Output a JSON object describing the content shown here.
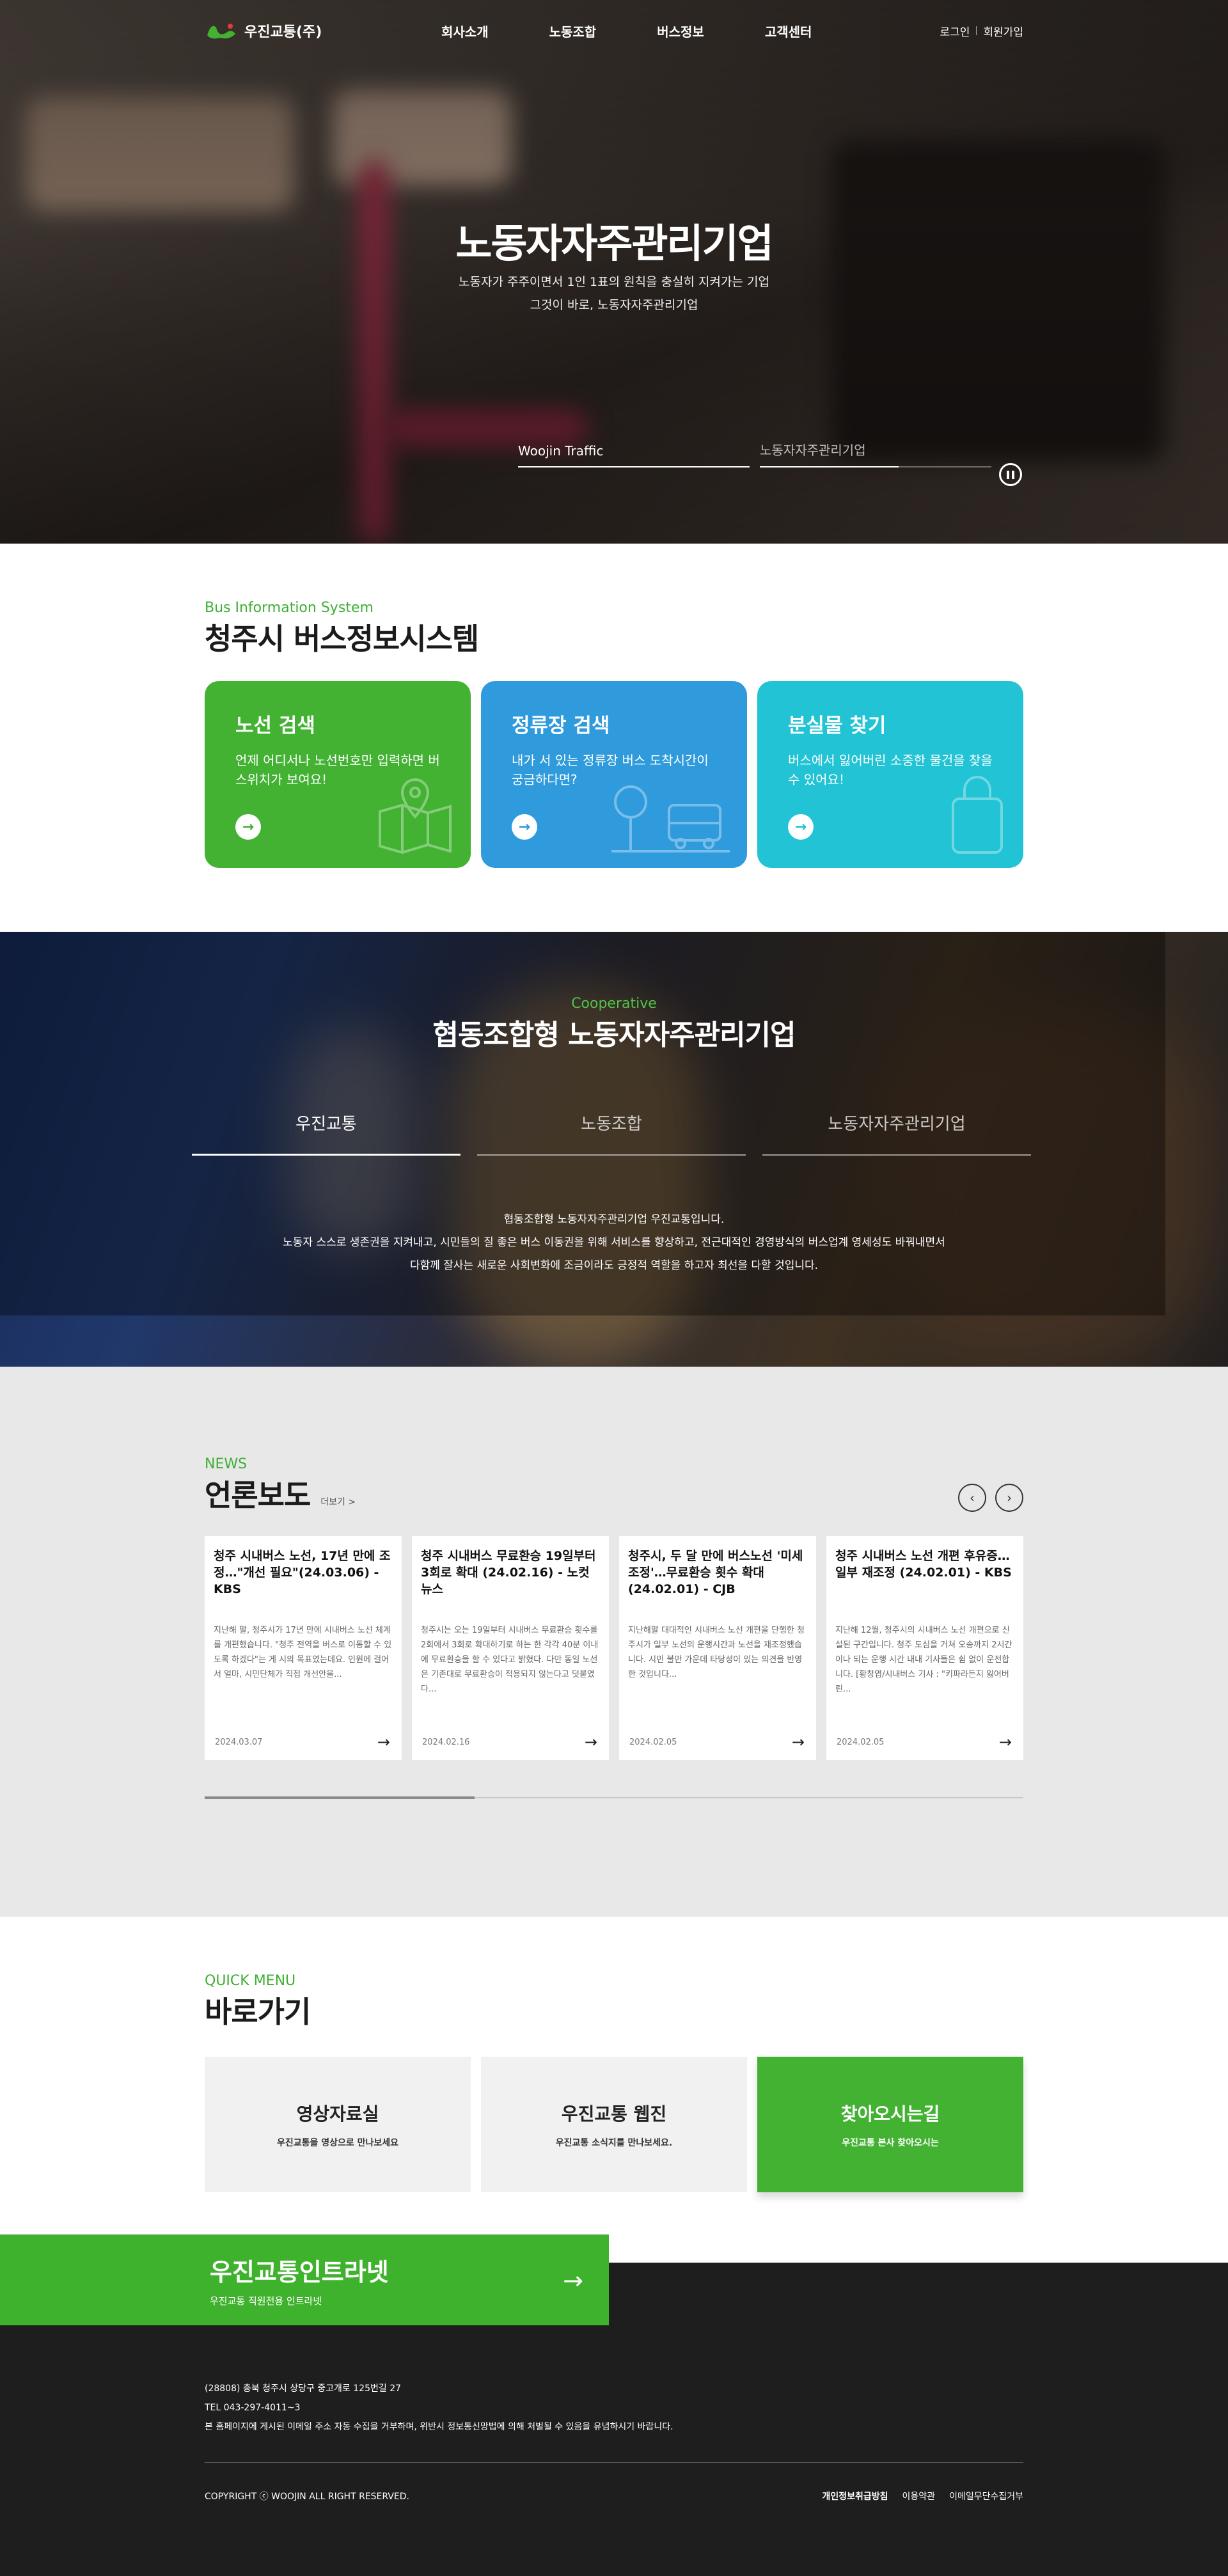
{
  "header": {
    "logo_text": "우진교통(주)",
    "nav": [
      "회사소개",
      "노동조합",
      "버스정보",
      "고객센터"
    ],
    "login": "로그인",
    "join": "회원가입"
  },
  "hero": {
    "title": "노동자자주관리기업",
    "line1": "노동자가 주주이면서 1인 1표의 원칙을 충실히 지켜가는 기업",
    "line2": "그것이 바로, 노동자자주관리기업",
    "tabs": [
      {
        "label": "Woojin Traffic",
        "progress": 1.0
      },
      {
        "label": "노동자자주관리기업",
        "progress": 0.6
      }
    ]
  },
  "bis": {
    "eyebrow": "Bus Information System",
    "title": "청주시 버스정보시스템",
    "cards": [
      {
        "title": "노선 검색",
        "desc": "언제 어디서나 노선번호만 입력하면 버스위치가 보여요!",
        "color": "#43b233",
        "icon": "map-pin-icon"
      },
      {
        "title": "정류장 검색",
        "desc": "내가 서 있는 정류장 버스 도착시간이 궁금하다면?",
        "color": "#2f9bdc",
        "icon": "bus-stop-icon"
      },
      {
        "title": "분실물 찾기",
        "desc": "버스에서 잃어버린 소중한 물건을 찾을 수 있어요!",
        "color": "#21c3d4",
        "icon": "bag-icon"
      }
    ]
  },
  "coop": {
    "eyebrow": "Cooperative",
    "title": "협동조합형 노동자자주관리기업",
    "tabs": [
      "우진교통",
      "노동조합",
      "노동자자주관리기업"
    ],
    "desc1": "협동조합형 노동자자주관리기업 우진교통입니다.",
    "desc2": "노동자 스스로 생존권을 지켜내고, 시민들의 질 좋은 버스 이동권을 위해 서비스를 향상하고, 전근대적인 경영방식의 버스업계 영세성도 바꿔내면서",
    "desc3": "다함께 잘사는 새로운 사회변화에 조금이라도 긍정적 역할을 하고자 최선을 다할 것입니다."
  },
  "news": {
    "eyebrow": "NEWS",
    "title": "언론보도",
    "more": "더보기 >",
    "items": [
      {
        "title": "청주 시내버스 노선, 17년 만에 조정…\"개선 필요\"(24.03.06) - KBS",
        "body": "지난해 말, 청주시가 17년 만에 시내버스 노선 체계를 개편했습니다. \"청주 전역을 버스로 이동할 수 있도록 하겠다\"는 게 시의 목표였는데요. 인원에 걸어서 얼마, 시민단체가 직접 개선안을...",
        "date": "2024.03.07"
      },
      {
        "title": "청주 시내버스 무료환승 19일부터 3회로 확대 (24.02.16) - 노컷뉴스",
        "body": "청주시는 오는 19일부터 시내버스 무료환승 횟수를 2회에서 3회로 확대하기로 하는 한 각각 40분 이내에 무료환승을 할 수 있다고 밝혔다. 다만 동일 노선은 기존대로 무료환승이 적용되지 않는다고 덧붙였다...",
        "date": "2024.02.16"
      },
      {
        "title": "청주시, 두 달 만에 버스노선 '미세조정'…무료환승 횟수 확대 (24.02.01) - CJB",
        "body": "지난해말 대대적인 시내버스 노선 개편을 단행한 청주시가 일부 노선의 운행시간과 노선을 재조정했습니다. 시민 불만 가운데 타당성이 있는 의견을 반영한 것입니다...",
        "date": "2024.02.05"
      },
      {
        "title": "청주 시내버스 노선 개편 후유증…일부 재조정 (24.02.01) - KBS",
        "body": "지난해 12월, 청주시의 시내버스 노선 개편으로 신설된 구간입니다. 청주 도심을 거쳐 오송까지 2시간이나 되는 운행 시간 내내 기사들은 쉼 없이 운전합니다. [황창엽/시내버스 기사 : \"키파라든지 잃어버린...",
        "date": "2024.02.05"
      }
    ],
    "progress": 0.33
  },
  "quick": {
    "eyebrow": "QUICK MENU",
    "title": "바로가기",
    "items": [
      {
        "title": "영상자료실",
        "desc": "우진교통을 영상으로 만나보세요",
        "active": false
      },
      {
        "title": "우진교통 웹진",
        "desc": "우진교통 소식지를 만나보세요.",
        "active": false
      },
      {
        "title": "찾아오시는길",
        "desc": "우진교통 본사 찾아오시는",
        "active": true
      }
    ]
  },
  "intranet": {
    "title": "우진교통인트라넷",
    "desc": "우진교통 직원전용 인트라넷"
  },
  "footer": {
    "addr": "(28808) 충북 청주시 상당구 중고개로 125번길 27",
    "tel": "TEL 043-297-4011~3",
    "notice": "본 홈페이지에 게시된 이메일 주소 자동 수집을 거부하며, 위반시 정보통신망법에 의해 처벌될 수 있음을 유념하시기 바랍니다.",
    "copyright": "COPYRIGHT ⓒ WOOJIN ALL RIGHT RESERVED.",
    "links": [
      "개인정보취급방침",
      "이용약관",
      "이메일무단수집거부"
    ]
  }
}
